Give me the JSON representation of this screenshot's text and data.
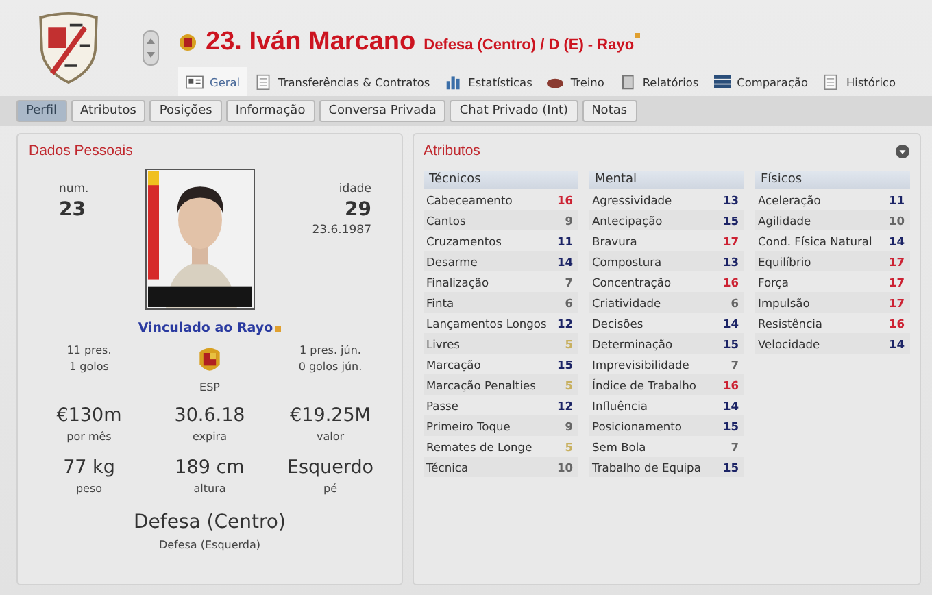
{
  "header": {
    "title": "23. Iván Marcano",
    "subtitle": "Defesa (Centro) / D (E) - Rayo"
  },
  "tabs": [
    {
      "label": "Geral",
      "selected": true
    },
    {
      "label": "Transferências & Contratos",
      "selected": false
    },
    {
      "label": "Estatísticas",
      "selected": false
    },
    {
      "label": "Treino",
      "selected": false
    },
    {
      "label": "Relatórios",
      "selected": false
    },
    {
      "label": "Comparação",
      "selected": false
    },
    {
      "label": "Histórico",
      "selected": false
    }
  ],
  "subtabs": [
    {
      "label": "Perfil",
      "selected": true
    },
    {
      "label": "Atributos",
      "selected": false
    },
    {
      "label": "Posições",
      "selected": false
    },
    {
      "label": "Informação",
      "selected": false
    },
    {
      "label": "Conversa Privada",
      "selected": false
    },
    {
      "label": "Chat Privado (Int)",
      "selected": false
    },
    {
      "label": "Notas",
      "selected": false
    }
  ],
  "personal": {
    "title": "Dados Pessoais",
    "number_label": "num.",
    "number": "23",
    "age_label": "idade",
    "age": "29",
    "birth_date": "23.6.1987",
    "contract_link": "Vinculado ao Rayo",
    "club_stats": [
      "11 pres.",
      "1 golos"
    ],
    "nation": "ESP",
    "youth_stats": [
      "1 pres. jún.",
      "0 golos jún."
    ],
    "facts": [
      {
        "value": "€130m",
        "label": "por mês"
      },
      {
        "value": "30.6.18",
        "label": "expira"
      },
      {
        "value": "€19.25M",
        "label": "valor"
      },
      {
        "value": "77 kg",
        "label": "peso"
      },
      {
        "value": "189 cm",
        "label": "altura"
      },
      {
        "value": "Esquerdo",
        "label": "pé"
      }
    ],
    "position": "Defesa (Centro)",
    "secondary_position": "Defesa (Esquerda)"
  },
  "attributes": {
    "title": "Atributos",
    "groups": [
      {
        "title": "Técnicos",
        "items": [
          {
            "name": "Cabeceamento",
            "value": "16",
            "color": "#cc2233"
          },
          {
            "name": "Cantos",
            "value": "9",
            "color": "#666666"
          },
          {
            "name": "Cruzamentos",
            "value": "11",
            "color": "#1c2466"
          },
          {
            "name": "Desarme",
            "value": "14",
            "color": "#1c2466"
          },
          {
            "name": "Finalização",
            "value": "7",
            "color": "#666666"
          },
          {
            "name": "Finta",
            "value": "6",
            "color": "#666666"
          },
          {
            "name": "Lançamentos Longos",
            "value": "12",
            "color": "#1c2466"
          },
          {
            "name": "Livres",
            "value": "5",
            "color": "#c8b060"
          },
          {
            "name": "Marcação",
            "value": "15",
            "color": "#1c2466"
          },
          {
            "name": "Marcação Penalties",
            "value": "5",
            "color": "#c8b060"
          },
          {
            "name": "Passe",
            "value": "12",
            "color": "#1c2466"
          },
          {
            "name": "Primeiro Toque",
            "value": "9",
            "color": "#666666"
          },
          {
            "name": "Remates de Longe",
            "value": "5",
            "color": "#c8b060"
          },
          {
            "name": "Técnica",
            "value": "10",
            "color": "#666666"
          }
        ]
      },
      {
        "title": "Mental",
        "items": [
          {
            "name": "Agressividade",
            "value": "13",
            "color": "#1c2466"
          },
          {
            "name": "Antecipação",
            "value": "15",
            "color": "#1c2466"
          },
          {
            "name": "Bravura",
            "value": "17",
            "color": "#cc2233"
          },
          {
            "name": "Compostura",
            "value": "13",
            "color": "#1c2466"
          },
          {
            "name": "Concentração",
            "value": "16",
            "color": "#cc2233"
          },
          {
            "name": "Criatividade",
            "value": "6",
            "color": "#666666"
          },
          {
            "name": "Decisões",
            "value": "14",
            "color": "#1c2466"
          },
          {
            "name": "Determinação",
            "value": "15",
            "color": "#1c2466"
          },
          {
            "name": "Imprevisibilidade",
            "value": "7",
            "color": "#666666"
          },
          {
            "name": "Índice de Trabalho",
            "value": "16",
            "color": "#cc2233"
          },
          {
            "name": "Influência",
            "value": "14",
            "color": "#1c2466"
          },
          {
            "name": "Posicionamento",
            "value": "15",
            "color": "#1c2466"
          },
          {
            "name": "Sem Bola",
            "value": "7",
            "color": "#666666"
          },
          {
            "name": "Trabalho de Equipa",
            "value": "15",
            "color": "#1c2466"
          }
        ]
      },
      {
        "title": "Físicos",
        "items": [
          {
            "name": "Aceleração",
            "value": "11",
            "color": "#1c2466"
          },
          {
            "name": "Agilidade",
            "value": "10",
            "color": "#666666"
          },
          {
            "name": "Cond. Física Natural",
            "value": "14",
            "color": "#1c2466"
          },
          {
            "name": "Equilíbrio",
            "value": "17",
            "color": "#cc2233"
          },
          {
            "name": "Força",
            "value": "17",
            "color": "#cc2233"
          },
          {
            "name": "Impulsão",
            "value": "17",
            "color": "#cc2233"
          },
          {
            "name": "Resistência",
            "value": "16",
            "color": "#cc2233"
          },
          {
            "name": "Velocidade",
            "value": "14",
            "color": "#1c2466"
          }
        ]
      }
    ]
  }
}
